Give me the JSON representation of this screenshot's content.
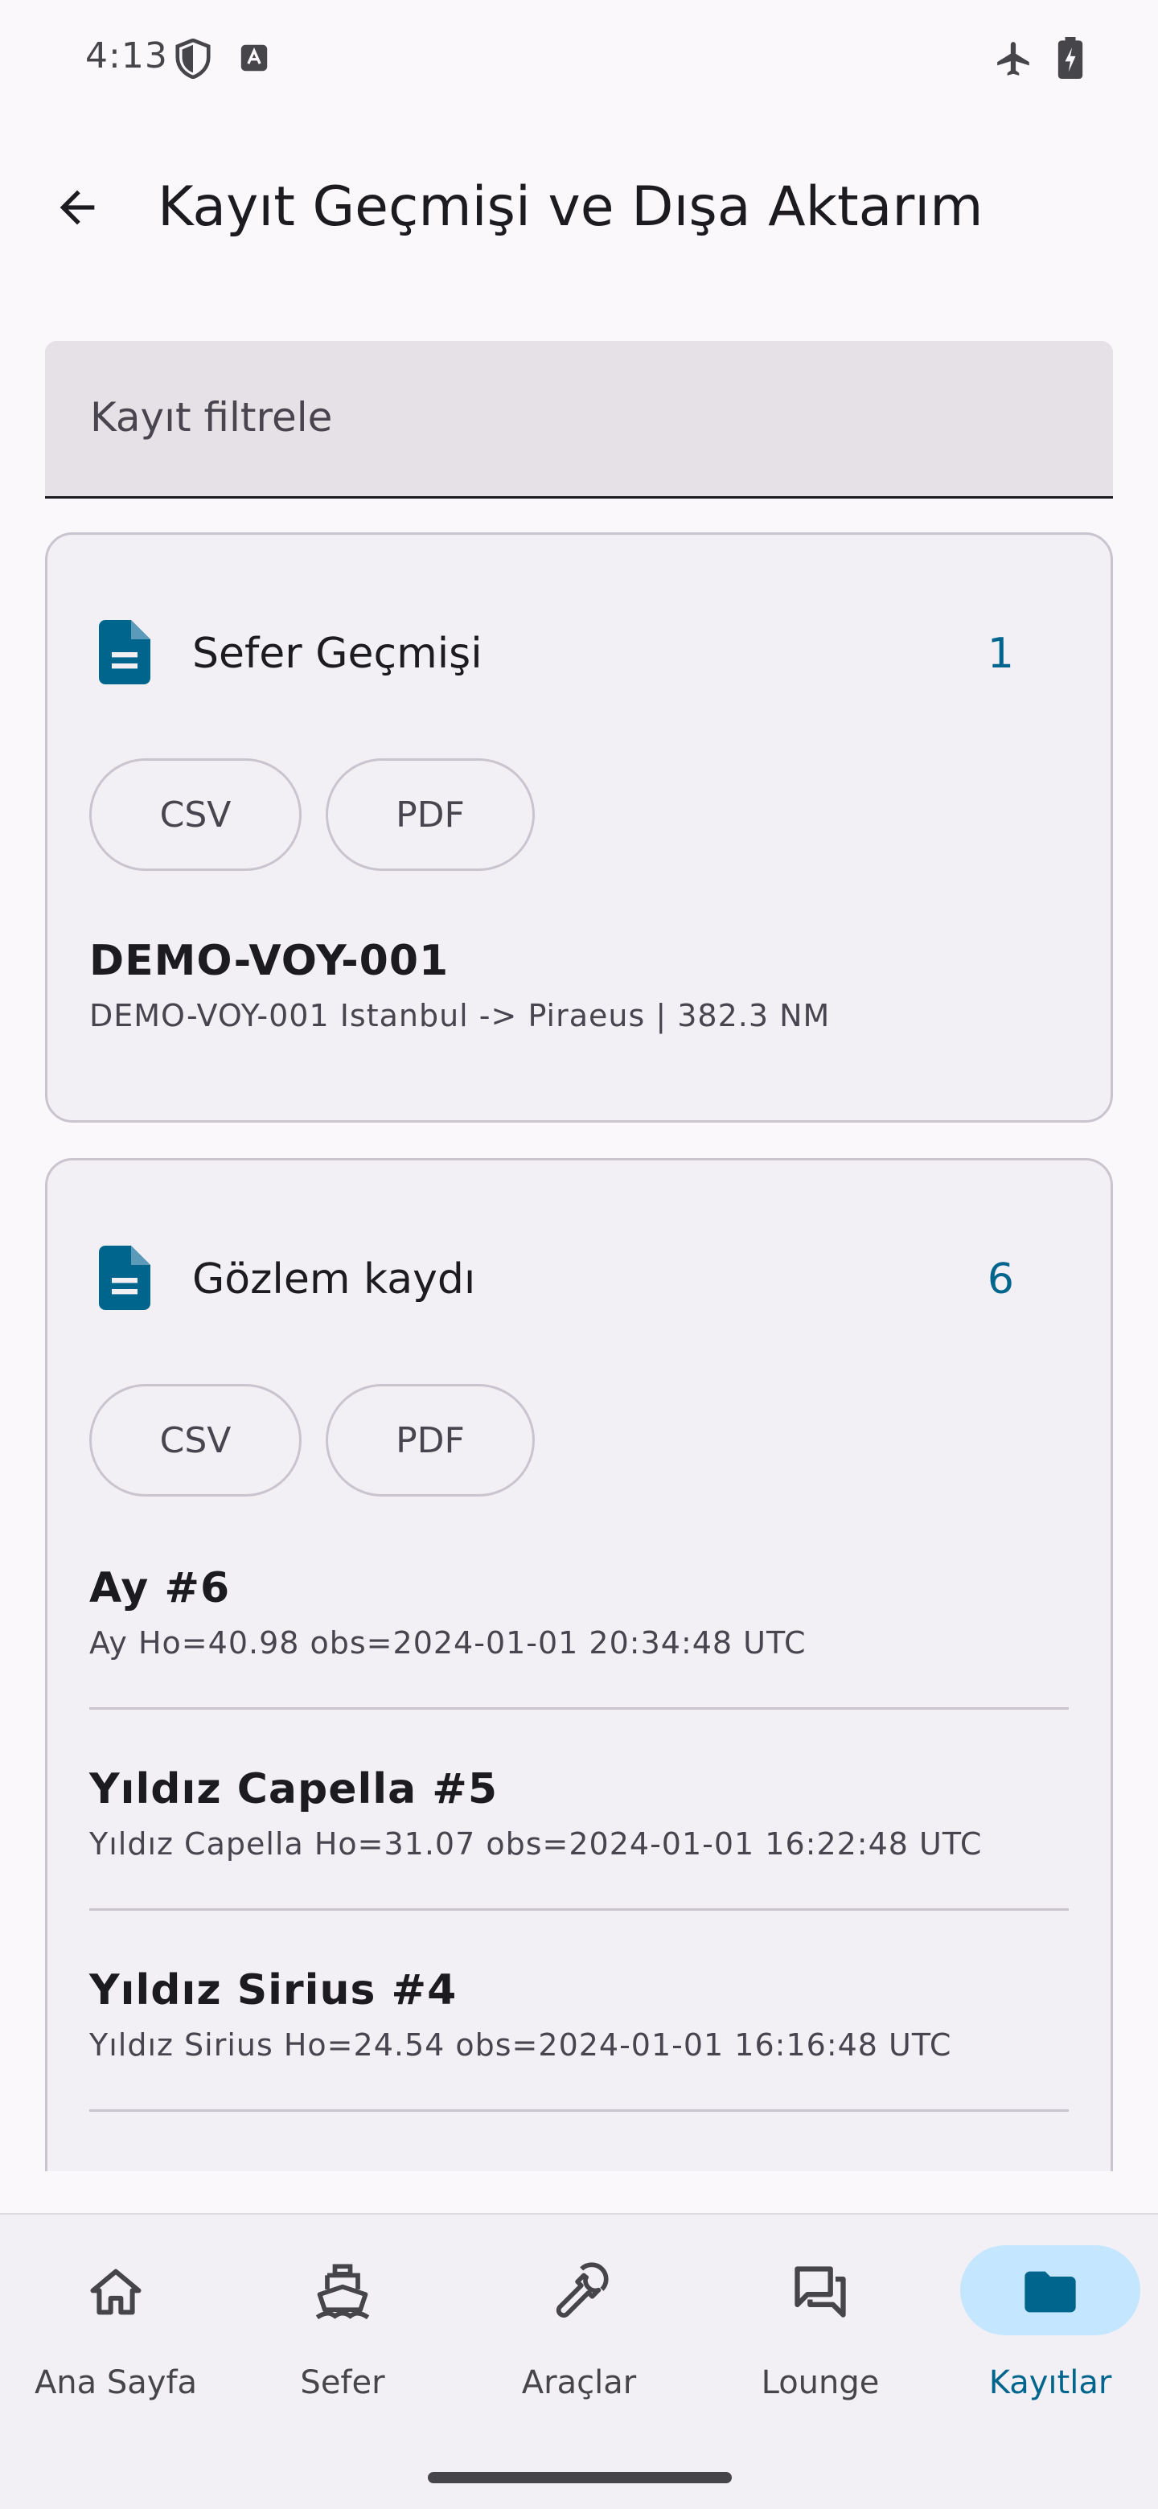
{
  "status_bar": {
    "time": "4:13",
    "icons": [
      "shield-icon",
      "keyboard-a-icon",
      "airplane-icon",
      "battery-charging-icon"
    ]
  },
  "app_bar": {
    "title": "Kayıt Geçmişi ve Dışa Aktarım",
    "back_icon": "arrow-left-icon"
  },
  "filter": {
    "placeholder": "Kayıt filtrele",
    "value": ""
  },
  "sections": [
    {
      "title": "Sefer Geçmişi",
      "count": "1",
      "icon": "document-icon",
      "csv_label": "CSV",
      "pdf_label": "PDF",
      "records": [
        {
          "title": "DEMO-VOY-001",
          "subtitle": "DEMO-VOY-001 Istanbul -> Piraeus | 382.3 NM"
        }
      ]
    },
    {
      "title": "Gözlem kaydı",
      "count": "6",
      "icon": "document-icon",
      "csv_label": "CSV",
      "pdf_label": "PDF",
      "records": [
        {
          "title": "Ay #6",
          "subtitle": "Ay Ho=40.98 obs=2024-01-01 20:34:48 UTC"
        },
        {
          "title": "Yıldız Capella #5",
          "subtitle": "Yıldız Capella Ho=31.07 obs=2024-01-01 16:22:48 UTC"
        },
        {
          "title": "Yıldız Sirius #4",
          "subtitle": "Yıldız Sirius Ho=24.54 obs=2024-01-01 16:16:48 UTC"
        }
      ]
    }
  ],
  "bottom_nav": {
    "items": [
      {
        "label": "Ana Sayfa",
        "icon": "home-icon",
        "active": false
      },
      {
        "label": "Sefer",
        "icon": "ship-icon",
        "active": false
      },
      {
        "label": "Araçlar",
        "icon": "wrench-icon",
        "active": false
      },
      {
        "label": "Lounge",
        "icon": "chat-bubbles-icon",
        "active": false
      },
      {
        "label": "Kayıtlar",
        "icon": "folder-icon",
        "active": true
      }
    ]
  },
  "colors": {
    "accent": "#00658d",
    "active_pill": "#c4e7ff",
    "background": "#faf8fb",
    "card_background": "#f3f0f5",
    "outline": "#cac4cf"
  }
}
